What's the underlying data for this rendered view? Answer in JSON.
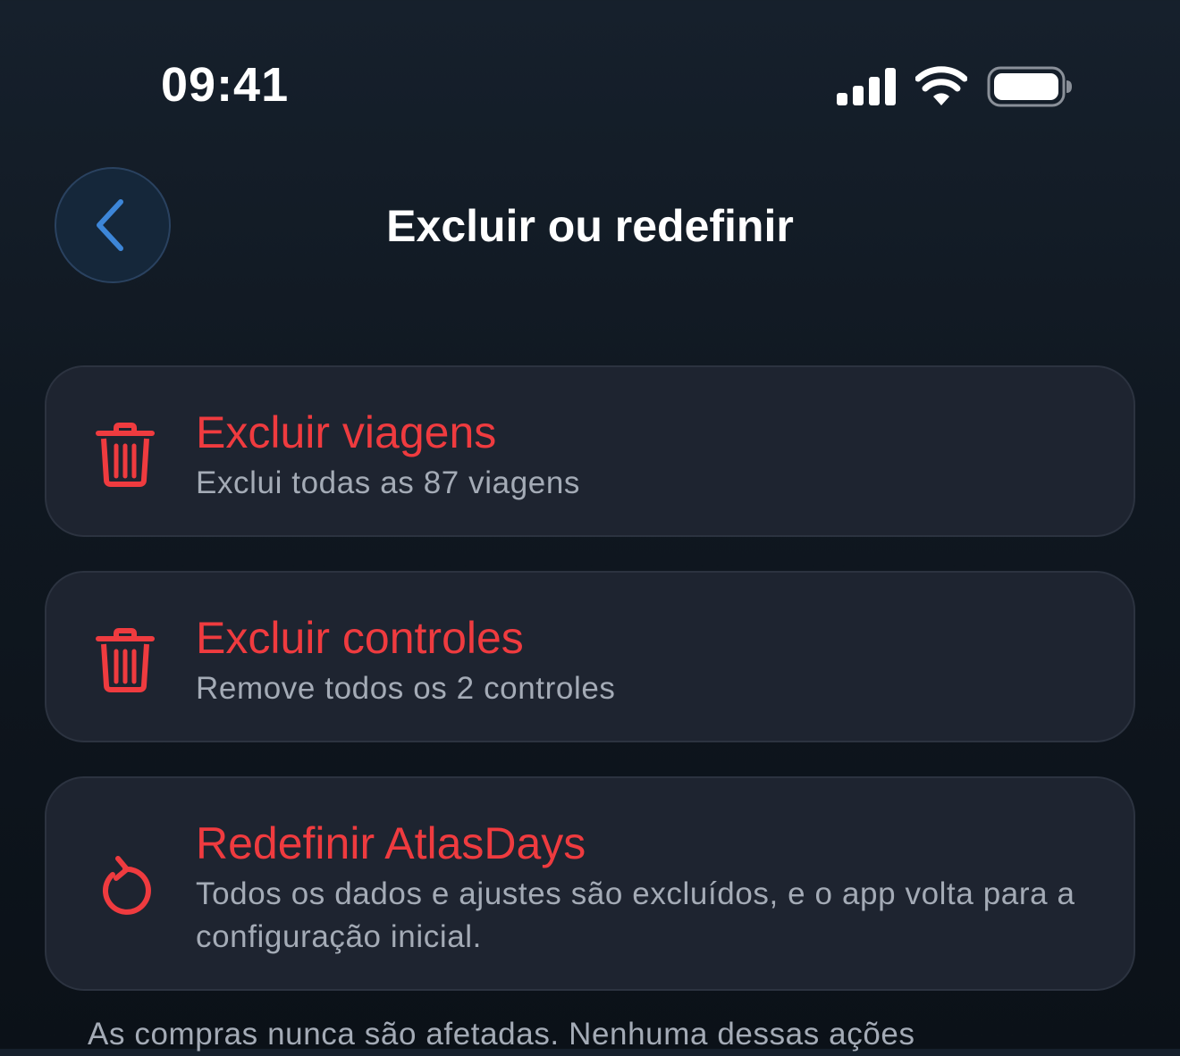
{
  "status_bar": {
    "time": "09:41",
    "signal_icon": "cellular-signal-icon",
    "wifi_icon": "wifi-icon",
    "battery_icon": "battery-icon"
  },
  "header": {
    "back_icon": "chevron-left-icon",
    "title": "Excluir ou redefinir"
  },
  "actions": [
    {
      "icon": "trash-icon",
      "title": "Excluir viagens",
      "subtitle": "Exclui todas as 87 viagens"
    },
    {
      "icon": "trash-icon",
      "title": "Excluir controles",
      "subtitle": "Remove todos os 2 controles"
    },
    {
      "icon": "reset-arrow-icon",
      "title": "Redefinir AtlasDays",
      "subtitle": "Todos os dados e ajustes são excluídos, e o app volta para a configuração inicial."
    }
  ],
  "footer": {
    "note": "As compras nunca são afetadas. Nenhuma dessas ações"
  },
  "colors": {
    "destructive": "#ef3b3f",
    "accent": "#3d86d8",
    "card_background": "#1e2430",
    "secondary_text": "#a4abb6"
  }
}
